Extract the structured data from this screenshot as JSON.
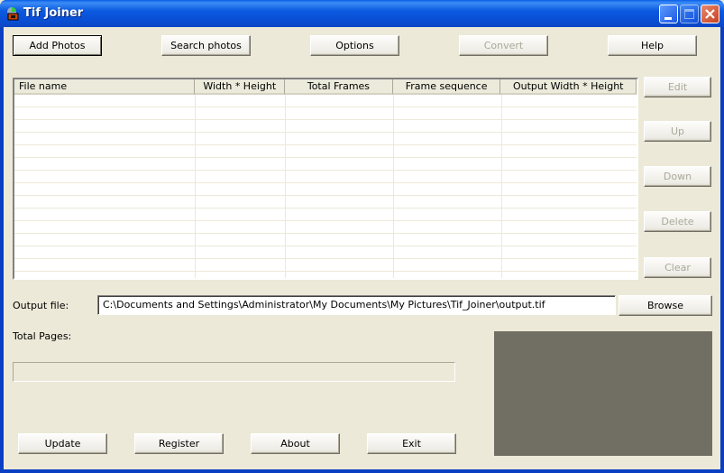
{
  "window": {
    "title": "Tif Joiner",
    "controls": [
      "minimize",
      "maximize",
      "close"
    ]
  },
  "toolbar": {
    "add_photos": "Add Photos",
    "search_photos": "Search photos",
    "options": "Options",
    "convert": "Convert",
    "help": "Help"
  },
  "file_list": {
    "columns": [
      "File name",
      "Width * Height",
      "Total Frames",
      "Frame sequence",
      "Output Width * Height"
    ],
    "rows": []
  },
  "side_buttons": {
    "edit": "Edit",
    "up": "Up",
    "down": "Down",
    "delete": "Delete",
    "clear": "Clear"
  },
  "output": {
    "label": "Output file:",
    "value": "C:\\Documents and Settings\\Administrator\\My Documents\\My Pictures\\Tif_Joiner\\output.tif",
    "browse": "Browse"
  },
  "total_pages": {
    "label": "Total Pages:",
    "progress": 0
  },
  "bottom_buttons": {
    "update": "Update",
    "register": "Register",
    "about": "About",
    "exit": "Exit"
  },
  "colors": {
    "titlebar": "#0a5ee8",
    "face": "#ece9d8",
    "preview_bg": "#716f64",
    "disabled_text": "#aca899"
  }
}
